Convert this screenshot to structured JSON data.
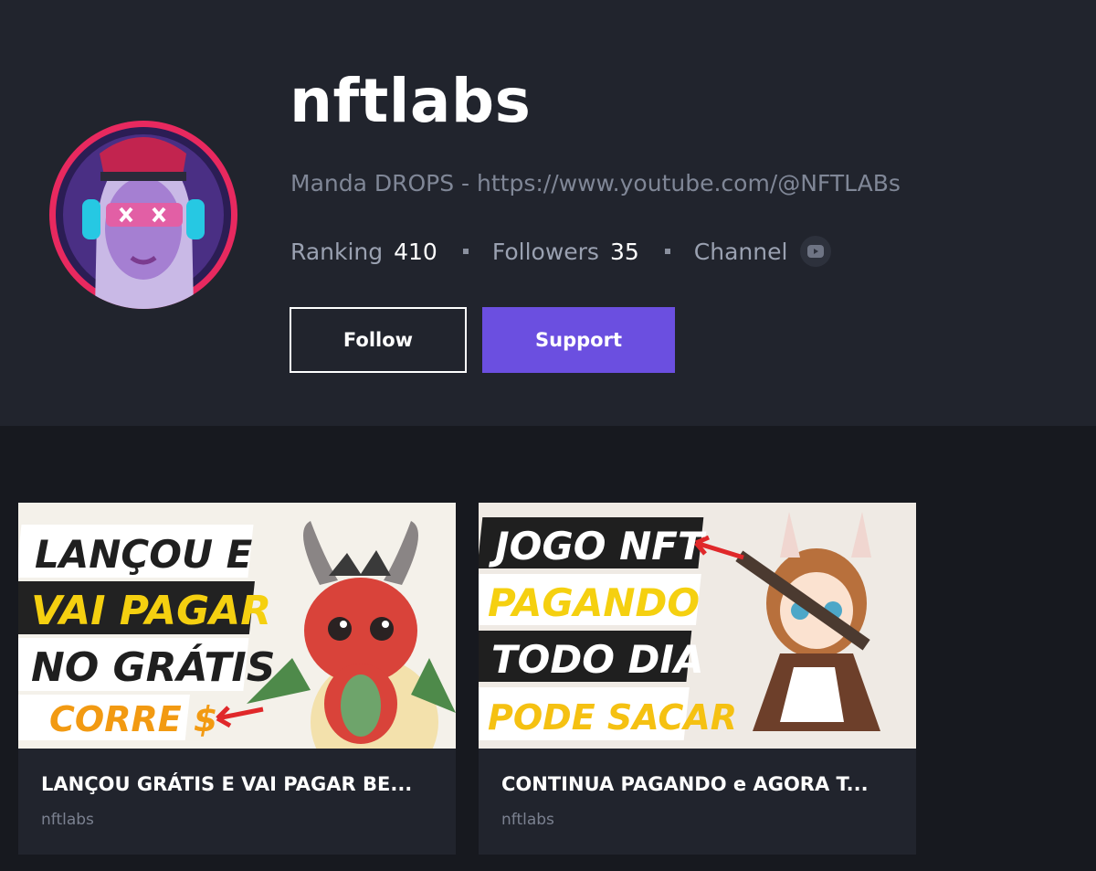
{
  "profile": {
    "name": "nftlabs",
    "bio": "Manda DROPS - https://www.youtube.com/@NFTLABs",
    "ranking_label": "Ranking",
    "ranking_value": "410",
    "followers_label": "Followers",
    "followers_value": "35",
    "channel_label": "Channel",
    "channel_icon": "youtube-icon"
  },
  "actions": {
    "follow_label": "Follow",
    "support_label": "Support"
  },
  "colors": {
    "accent": "#6b4fe0",
    "avatar_ring": "#e8295f",
    "header_bg": "#21242d",
    "page_bg": "#17191f"
  },
  "cards": [
    {
      "title": "LANÇOU GRÁTIS E VAI PAGAR BE...",
      "author": "nftlabs",
      "thumb_lines": [
        "LANÇOU E",
        "VAI PAGAR",
        "NO GRÁTIS",
        "CORRE $"
      ]
    },
    {
      "title": "CONTINUA PAGANDO e AGORA T...",
      "author": "nftlabs",
      "thumb_lines": [
        "JOGO NFT",
        "PAGANDO",
        "TODO DIA",
        "PODE SACAR"
      ]
    }
  ]
}
